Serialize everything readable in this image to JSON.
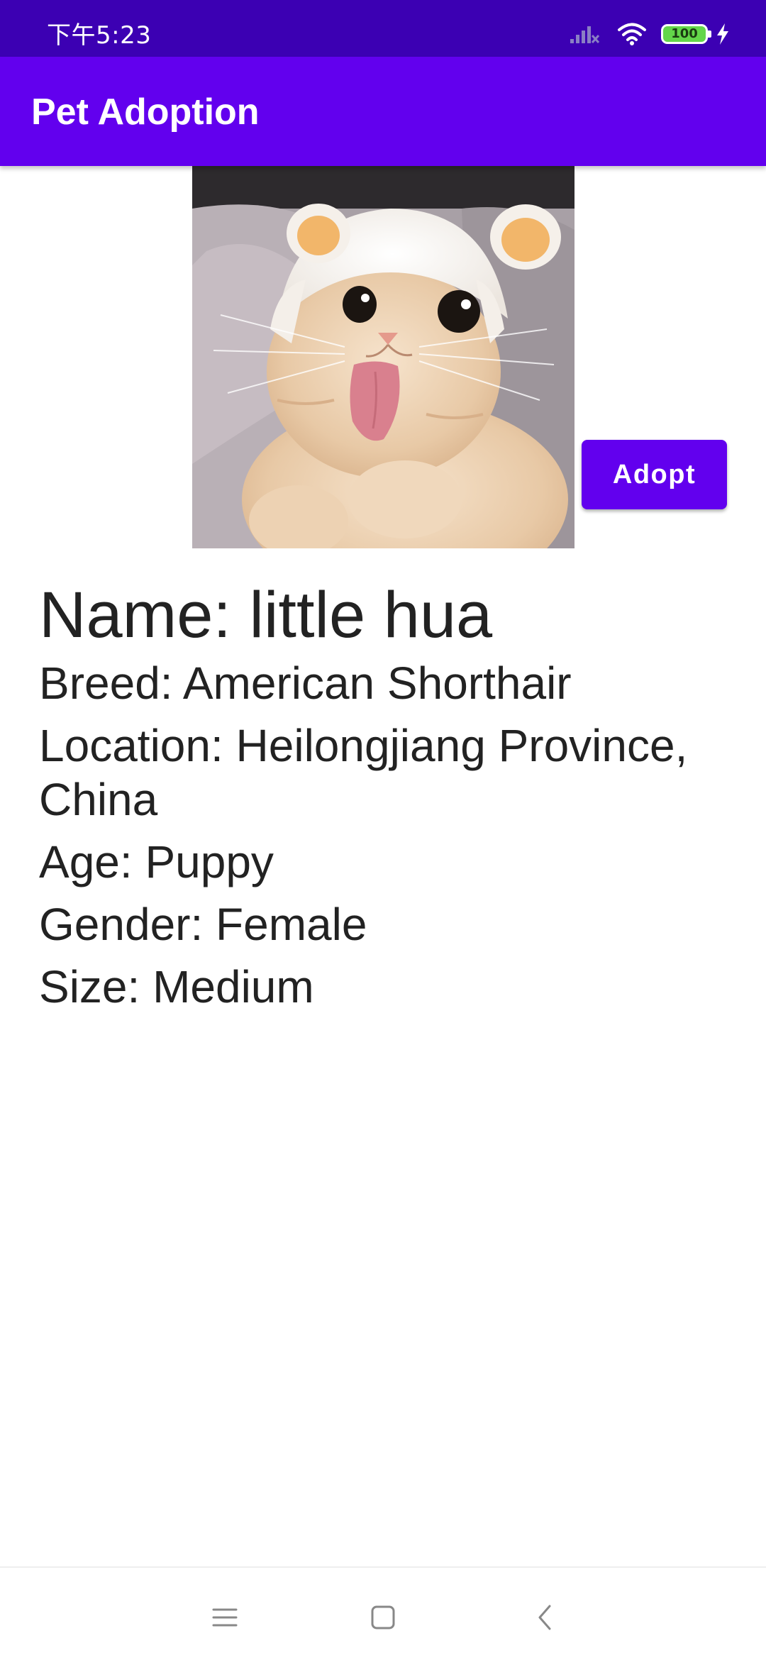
{
  "status_bar": {
    "time": "下午5:23",
    "battery_level": "100",
    "icons": [
      "signal-icon",
      "wifi-icon",
      "battery-icon",
      "charging-bolt-icon"
    ]
  },
  "app_bar": {
    "title": "Pet Adoption"
  },
  "pet": {
    "photo_alt": "cat-photo",
    "name": "Name: little hua",
    "breed": "Breed: American Shorthair",
    "location": "Location: Heilongjiang Province, China",
    "age": "Age: Puppy",
    "gender": "Gender: Female",
    "size": "Size: Medium"
  },
  "actions": {
    "adopt_label": "Adopt"
  },
  "nav_bar": {
    "icons": [
      "menu-icon",
      "home-square-icon",
      "back-chevron-icon"
    ]
  },
  "colors": {
    "status_bar": "#3c00b3",
    "primary": "#6200ee",
    "text": "#222222",
    "background": "#ffffff"
  }
}
